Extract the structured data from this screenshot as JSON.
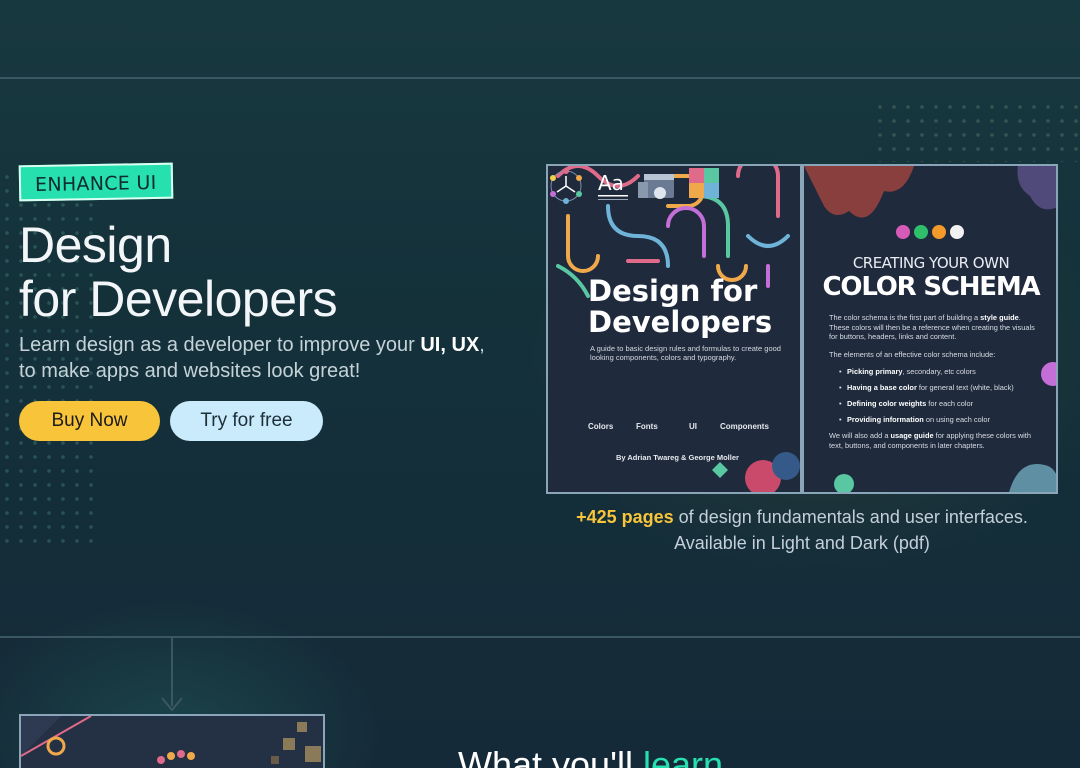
{
  "hero": {
    "badge": "ENHANCE UI",
    "headline_line1": "Design",
    "headline_line2": "for Developers",
    "subtitle_part1": "Learn design as a developer to improve your ",
    "subtitle_ui": "UI",
    "subtitle_sep": ", ",
    "subtitle_ux": "UX",
    "subtitle_part2": ", to make apps and websites look great!",
    "buy_label": "Buy Now",
    "try_label": "Try for free"
  },
  "book": {
    "cover_title_line1": "Design for",
    "cover_title_line2": "Developers",
    "cover_subtitle": "A guide to basic design rules and formulas to create good looking components, colors and typography.",
    "icons": [
      {
        "name": "colors-icon",
        "label": "Colors"
      },
      {
        "name": "fonts-icon",
        "label": "Fonts",
        "glyph": "Aa"
      },
      {
        "name": "ui-icon",
        "label": "UI"
      },
      {
        "name": "components-icon",
        "label": "Components"
      }
    ],
    "author": "By Adrian Twareg & George Moller",
    "right_kicker": "CREATING YOUR OWN",
    "right_title": "COLOR SCHEMA",
    "right_p1_a": "The color schema is the first part of building a ",
    "right_p1_b": "style guide",
    "right_p1_c": ". These colors will then be a reference when creating the visuals for buttons, headers, links and content.",
    "right_p2": "The elements of an effective color schema include:",
    "list": [
      {
        "bold": "Picking primary",
        "rest": ", secondary, etc colors"
      },
      {
        "bold": "Having a base color",
        "rest": " for general text (white, black)"
      },
      {
        "bold": "Defining color weights",
        "rest": " for each color"
      },
      {
        "bold": "Providing information",
        "rest": " on using each color"
      }
    ],
    "right_p3_a": "We will also add a ",
    "right_p3_b": "usage guide",
    "right_p3_c": " for applying these colors with text, buttons, and components in later chapters.",
    "swatches": [
      "#d65ab8",
      "#2fbf6a",
      "#f39a2a",
      "#f2f2f2"
    ]
  },
  "caption": {
    "highlight": "+425 pages",
    "rest_line1": " of design fundamentals and user interfaces.",
    "line2": "Available in Light and Dark (pdf)"
  },
  "learn": {
    "prefix": "What you'll ",
    "accent": "learn"
  },
  "colors": {
    "accent": "#27e0b0",
    "buy": "#f8c43a",
    "try": "#c9ebfb",
    "background": "#14303a"
  }
}
